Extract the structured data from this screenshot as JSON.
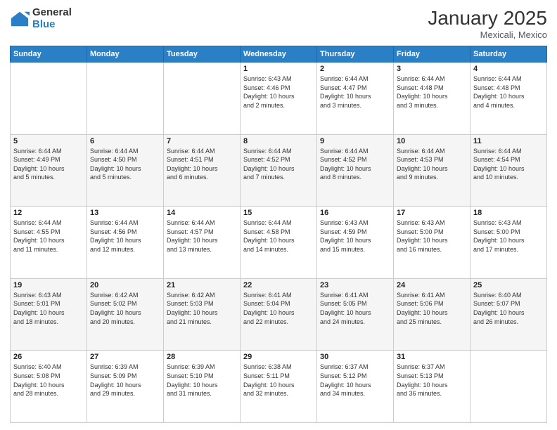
{
  "logo": {
    "general": "General",
    "blue": "Blue"
  },
  "title": "January 2025",
  "location": "Mexicali, Mexico",
  "days_of_week": [
    "Sunday",
    "Monday",
    "Tuesday",
    "Wednesday",
    "Thursday",
    "Friday",
    "Saturday"
  ],
  "weeks": [
    [
      {
        "num": "",
        "detail": ""
      },
      {
        "num": "",
        "detail": ""
      },
      {
        "num": "",
        "detail": ""
      },
      {
        "num": "1",
        "detail": "Sunrise: 6:43 AM\nSunset: 4:46 PM\nDaylight: 10 hours\nand 2 minutes."
      },
      {
        "num": "2",
        "detail": "Sunrise: 6:44 AM\nSunset: 4:47 PM\nDaylight: 10 hours\nand 3 minutes."
      },
      {
        "num": "3",
        "detail": "Sunrise: 6:44 AM\nSunset: 4:48 PM\nDaylight: 10 hours\nand 3 minutes."
      },
      {
        "num": "4",
        "detail": "Sunrise: 6:44 AM\nSunset: 4:48 PM\nDaylight: 10 hours\nand 4 minutes."
      }
    ],
    [
      {
        "num": "5",
        "detail": "Sunrise: 6:44 AM\nSunset: 4:49 PM\nDaylight: 10 hours\nand 5 minutes."
      },
      {
        "num": "6",
        "detail": "Sunrise: 6:44 AM\nSunset: 4:50 PM\nDaylight: 10 hours\nand 5 minutes."
      },
      {
        "num": "7",
        "detail": "Sunrise: 6:44 AM\nSunset: 4:51 PM\nDaylight: 10 hours\nand 6 minutes."
      },
      {
        "num": "8",
        "detail": "Sunrise: 6:44 AM\nSunset: 4:52 PM\nDaylight: 10 hours\nand 7 minutes."
      },
      {
        "num": "9",
        "detail": "Sunrise: 6:44 AM\nSunset: 4:52 PM\nDaylight: 10 hours\nand 8 minutes."
      },
      {
        "num": "10",
        "detail": "Sunrise: 6:44 AM\nSunset: 4:53 PM\nDaylight: 10 hours\nand 9 minutes."
      },
      {
        "num": "11",
        "detail": "Sunrise: 6:44 AM\nSunset: 4:54 PM\nDaylight: 10 hours\nand 10 minutes."
      }
    ],
    [
      {
        "num": "12",
        "detail": "Sunrise: 6:44 AM\nSunset: 4:55 PM\nDaylight: 10 hours\nand 11 minutes."
      },
      {
        "num": "13",
        "detail": "Sunrise: 6:44 AM\nSunset: 4:56 PM\nDaylight: 10 hours\nand 12 minutes."
      },
      {
        "num": "14",
        "detail": "Sunrise: 6:44 AM\nSunset: 4:57 PM\nDaylight: 10 hours\nand 13 minutes."
      },
      {
        "num": "15",
        "detail": "Sunrise: 6:44 AM\nSunset: 4:58 PM\nDaylight: 10 hours\nand 14 minutes."
      },
      {
        "num": "16",
        "detail": "Sunrise: 6:43 AM\nSunset: 4:59 PM\nDaylight: 10 hours\nand 15 minutes."
      },
      {
        "num": "17",
        "detail": "Sunrise: 6:43 AM\nSunset: 5:00 PM\nDaylight: 10 hours\nand 16 minutes."
      },
      {
        "num": "18",
        "detail": "Sunrise: 6:43 AM\nSunset: 5:00 PM\nDaylight: 10 hours\nand 17 minutes."
      }
    ],
    [
      {
        "num": "19",
        "detail": "Sunrise: 6:43 AM\nSunset: 5:01 PM\nDaylight: 10 hours\nand 18 minutes."
      },
      {
        "num": "20",
        "detail": "Sunrise: 6:42 AM\nSunset: 5:02 PM\nDaylight: 10 hours\nand 20 minutes."
      },
      {
        "num": "21",
        "detail": "Sunrise: 6:42 AM\nSunset: 5:03 PM\nDaylight: 10 hours\nand 21 minutes."
      },
      {
        "num": "22",
        "detail": "Sunrise: 6:41 AM\nSunset: 5:04 PM\nDaylight: 10 hours\nand 22 minutes."
      },
      {
        "num": "23",
        "detail": "Sunrise: 6:41 AM\nSunset: 5:05 PM\nDaylight: 10 hours\nand 24 minutes."
      },
      {
        "num": "24",
        "detail": "Sunrise: 6:41 AM\nSunset: 5:06 PM\nDaylight: 10 hours\nand 25 minutes."
      },
      {
        "num": "25",
        "detail": "Sunrise: 6:40 AM\nSunset: 5:07 PM\nDaylight: 10 hours\nand 26 minutes."
      }
    ],
    [
      {
        "num": "26",
        "detail": "Sunrise: 6:40 AM\nSunset: 5:08 PM\nDaylight: 10 hours\nand 28 minutes."
      },
      {
        "num": "27",
        "detail": "Sunrise: 6:39 AM\nSunset: 5:09 PM\nDaylight: 10 hours\nand 29 minutes."
      },
      {
        "num": "28",
        "detail": "Sunrise: 6:39 AM\nSunset: 5:10 PM\nDaylight: 10 hours\nand 31 minutes."
      },
      {
        "num": "29",
        "detail": "Sunrise: 6:38 AM\nSunset: 5:11 PM\nDaylight: 10 hours\nand 32 minutes."
      },
      {
        "num": "30",
        "detail": "Sunrise: 6:37 AM\nSunset: 5:12 PM\nDaylight: 10 hours\nand 34 minutes."
      },
      {
        "num": "31",
        "detail": "Sunrise: 6:37 AM\nSunset: 5:13 PM\nDaylight: 10 hours\nand 36 minutes."
      },
      {
        "num": "",
        "detail": ""
      }
    ]
  ]
}
